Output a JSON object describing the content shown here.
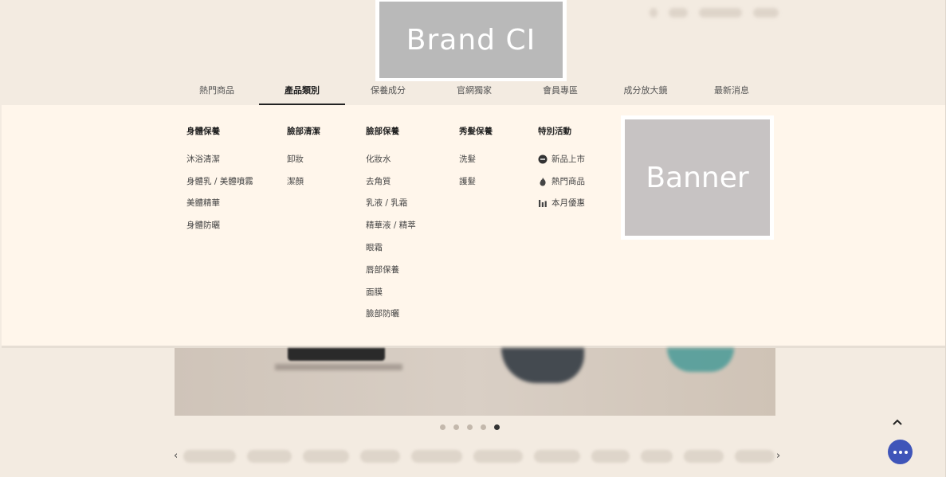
{
  "brand": {
    "placeholder_text": "Brand CI"
  },
  "nav": {
    "items": [
      {
        "label": "熱門商品",
        "active": false
      },
      {
        "label": "產品類別",
        "active": true
      },
      {
        "label": "保養成分",
        "active": false
      },
      {
        "label": "官網獨家",
        "active": false
      },
      {
        "label": "會員專區",
        "active": false
      },
      {
        "label": "成分放大鏡",
        "active": false
      },
      {
        "label": "最新消息",
        "active": false
      }
    ]
  },
  "mega_menu": {
    "columns": [
      {
        "heading": "身體保養",
        "links": [
          "沐浴清潔",
          "身體乳 / 美體噴霧",
          "美體精華",
          "身體防曬"
        ]
      },
      {
        "heading": "臉部清潔",
        "links": [
          "卸妝",
          "潔顏"
        ]
      },
      {
        "heading": "臉部保養",
        "links": [
          "化妝水",
          "去角質",
          "乳液 / 乳霜",
          "精華液 / 精萃",
          "眼霜",
          "唇部保養",
          "面膜",
          "臉部防曬"
        ]
      },
      {
        "heading": "秀髮保養",
        "links": [
          "洗髮",
          "護髮"
        ]
      },
      {
        "heading": "特別活動",
        "links": [
          {
            "label": "新品上市",
            "icon": "new-badge-icon"
          },
          {
            "label": "熱門商品",
            "icon": "flame-icon"
          },
          {
            "label": "本月優惠",
            "icon": "bar-chart-icon"
          }
        ]
      }
    ],
    "banner_placeholder": "Banner"
  },
  "carousel": {
    "total_slides": 5,
    "active_slide": 5
  },
  "colors": {
    "accent": "#3f55b9",
    "menu_bg": "#fff6eb",
    "page_bg": "#f3ebe1"
  }
}
